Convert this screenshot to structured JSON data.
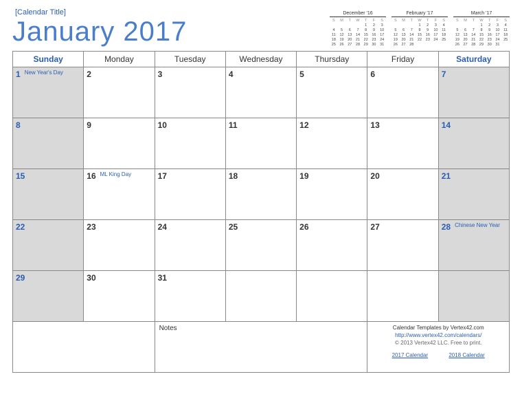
{
  "header": {
    "subtitle": "[Calendar Title]",
    "title": "January  2017"
  },
  "miniCalendars": [
    {
      "title": "December '16",
      "dow": [
        "S",
        "M",
        "T",
        "W",
        "T",
        "F",
        "S"
      ],
      "rows": [
        [
          "",
          "",
          "",
          "",
          "1",
          "2",
          "3"
        ],
        [
          "4",
          "5",
          "6",
          "7",
          "8",
          "9",
          "10"
        ],
        [
          "11",
          "12",
          "13",
          "14",
          "15",
          "16",
          "17"
        ],
        [
          "18",
          "19",
          "20",
          "21",
          "22",
          "23",
          "24"
        ],
        [
          "25",
          "26",
          "27",
          "28",
          "29",
          "30",
          "31"
        ]
      ]
    },
    {
      "title": "February '17",
      "dow": [
        "S",
        "M",
        "T",
        "W",
        "T",
        "F",
        "S"
      ],
      "rows": [
        [
          "",
          "",
          "",
          "1",
          "2",
          "3",
          "4"
        ],
        [
          "5",
          "6",
          "7",
          "8",
          "9",
          "10",
          "11"
        ],
        [
          "12",
          "13",
          "14",
          "15",
          "16",
          "17",
          "18"
        ],
        [
          "19",
          "20",
          "21",
          "22",
          "23",
          "24",
          "25"
        ],
        [
          "26",
          "27",
          "28",
          "",
          "",
          "",
          ""
        ]
      ]
    },
    {
      "title": "March '17",
      "dow": [
        "S",
        "M",
        "T",
        "W",
        "T",
        "F",
        "S"
      ],
      "rows": [
        [
          "",
          "",
          "",
          "1",
          "2",
          "3",
          "4"
        ],
        [
          "5",
          "6",
          "7",
          "8",
          "9",
          "10",
          "11"
        ],
        [
          "12",
          "13",
          "14",
          "15",
          "16",
          "17",
          "18"
        ],
        [
          "19",
          "20",
          "21",
          "22",
          "23",
          "24",
          "25"
        ],
        [
          "26",
          "27",
          "28",
          "29",
          "30",
          "31",
          ""
        ]
      ]
    }
  ],
  "daysOfWeek": [
    "Sunday",
    "Monday",
    "Tuesday",
    "Wednesday",
    "Thursday",
    "Friday",
    "Saturday"
  ],
  "weeks": [
    [
      {
        "num": "1",
        "event": "New Year's Day",
        "weekend": true
      },
      {
        "num": "2"
      },
      {
        "num": "3"
      },
      {
        "num": "4"
      },
      {
        "num": "5"
      },
      {
        "num": "6"
      },
      {
        "num": "7",
        "weekend": true
      }
    ],
    [
      {
        "num": "8",
        "weekend": true
      },
      {
        "num": "9"
      },
      {
        "num": "10"
      },
      {
        "num": "11"
      },
      {
        "num": "12"
      },
      {
        "num": "13"
      },
      {
        "num": "14",
        "weekend": true
      }
    ],
    [
      {
        "num": "15",
        "weekend": true
      },
      {
        "num": "16",
        "event": "ML King Day"
      },
      {
        "num": "17"
      },
      {
        "num": "18"
      },
      {
        "num": "19"
      },
      {
        "num": "20"
      },
      {
        "num": "21",
        "weekend": true
      }
    ],
    [
      {
        "num": "22",
        "weekend": true
      },
      {
        "num": "23"
      },
      {
        "num": "24"
      },
      {
        "num": "25"
      },
      {
        "num": "26"
      },
      {
        "num": "27"
      },
      {
        "num": "28",
        "event": "Chinese New Year",
        "weekend": true
      }
    ],
    [
      {
        "num": "29",
        "weekend": true
      },
      {
        "num": "30"
      },
      {
        "num": "31"
      },
      {
        "num": ""
      },
      {
        "num": ""
      },
      {
        "num": ""
      },
      {
        "num": "",
        "weekend": true
      }
    ]
  ],
  "footer": {
    "notesLabel": "Notes",
    "credits": {
      "line1": "Calendar Templates by Vertex42.com",
      "line2": "http://www.vertex42.com/calendars/",
      "line3": "© 2013 Vertex42 LLC. Free to print."
    },
    "links": {
      "left": "2017 Calendar",
      "right": "2018 Calendar"
    }
  }
}
